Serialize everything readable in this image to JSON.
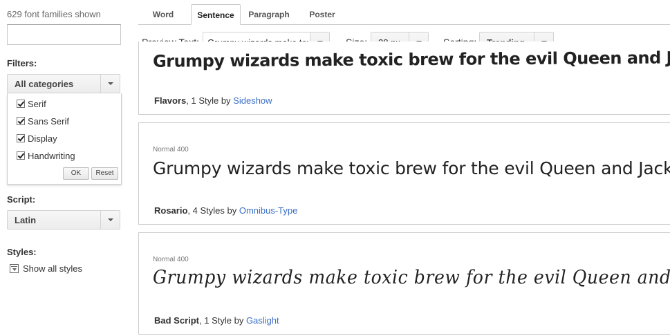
{
  "sidebar": {
    "family_count": "629 font families shown",
    "search_placeholder": "",
    "filters_label": "Filters:",
    "category_select": "All categories",
    "categories": [
      {
        "label": "Serif",
        "checked": true
      },
      {
        "label": "Sans Serif",
        "checked": true
      },
      {
        "label": "Display",
        "checked": true
      },
      {
        "label": "Handwriting",
        "checked": true
      }
    ],
    "ok_label": "OK",
    "reset_label": "Reset",
    "script_label": "Script:",
    "script_select": "Latin",
    "styles_label": "Styles:",
    "show_all_styles": "Show all styles"
  },
  "tabs": [
    {
      "label": "Word",
      "active": false
    },
    {
      "label": "Sentence",
      "active": true
    },
    {
      "label": "Paragraph",
      "active": false
    },
    {
      "label": "Poster",
      "active": false
    }
  ],
  "toolbar": {
    "preview_label": "Preview Text:",
    "preview_value": "Grumpy wizards make tox",
    "size_label": "Size:",
    "size_value": "28 px",
    "sorting_label": "Sorting:",
    "sorting_value": "Trending"
  },
  "fonts": [
    {
      "style": "",
      "sample": "Grumpy wizards make toxic brew for the evil Queen and Jack.",
      "name": "Flavors",
      "styles_count": ", 1 Style by ",
      "designer": "Sideshow"
    },
    {
      "style": "Normal 400",
      "sample": "Grumpy wizards make toxic brew for the evil Queen and Jack.",
      "name": "Rosario",
      "styles_count": ", 4 Styles by ",
      "designer": "Omnibus-Type"
    },
    {
      "style": "Normal 400",
      "sample": "Grumpy wizards make toxic brew for the evil Queen and Jack.",
      "name": "Bad Script",
      "styles_count": ", 1 Style by ",
      "designer": "Gaslight"
    }
  ],
  "colors": {
    "link": "#3a6ec7",
    "border": "#cccccc",
    "text": "#333333"
  }
}
